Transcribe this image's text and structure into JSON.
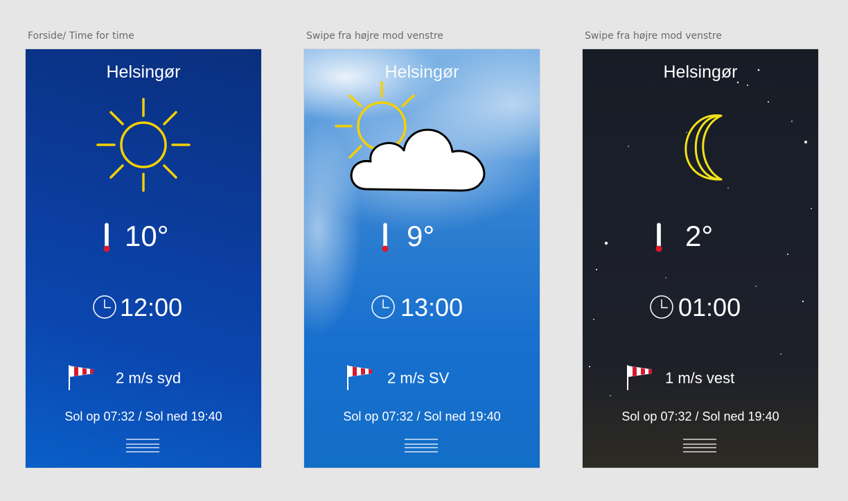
{
  "screens": [
    {
      "label": "Forside/ Time for time",
      "city": "Helsingør",
      "weather_icon": "sun-icon",
      "temperature": "10°",
      "time": "12:00",
      "wind": "2 m/s syd",
      "sun_times": "Sol op 07:32 / Sol ned 19:40"
    },
    {
      "label": "Swipe fra højre mod venstre",
      "city": "Helsingør",
      "weather_icon": "partly-cloudy-icon",
      "temperature": "9°",
      "time": "13:00",
      "wind": "2 m/s SV",
      "sun_times": "Sol op 07:32 / Sol ned 19:40"
    },
    {
      "label": "Swipe fra højre mod venstre",
      "city": "Helsingør",
      "weather_icon": "moon-icon",
      "temperature": "2°",
      "time": "01:00",
      "wind": "1 m/s vest",
      "sun_times": "Sol op 07:32 / Sol ned 19:40"
    }
  ],
  "colors": {
    "sun": "#f5d000",
    "moon": "#f0e21b",
    "thermometer_bulb": "#e0162b",
    "windsock_red": "#d9182d",
    "day_background": "#0b3f9f",
    "sky_background": "#1f74cf",
    "night_background": "#1b1f29"
  }
}
